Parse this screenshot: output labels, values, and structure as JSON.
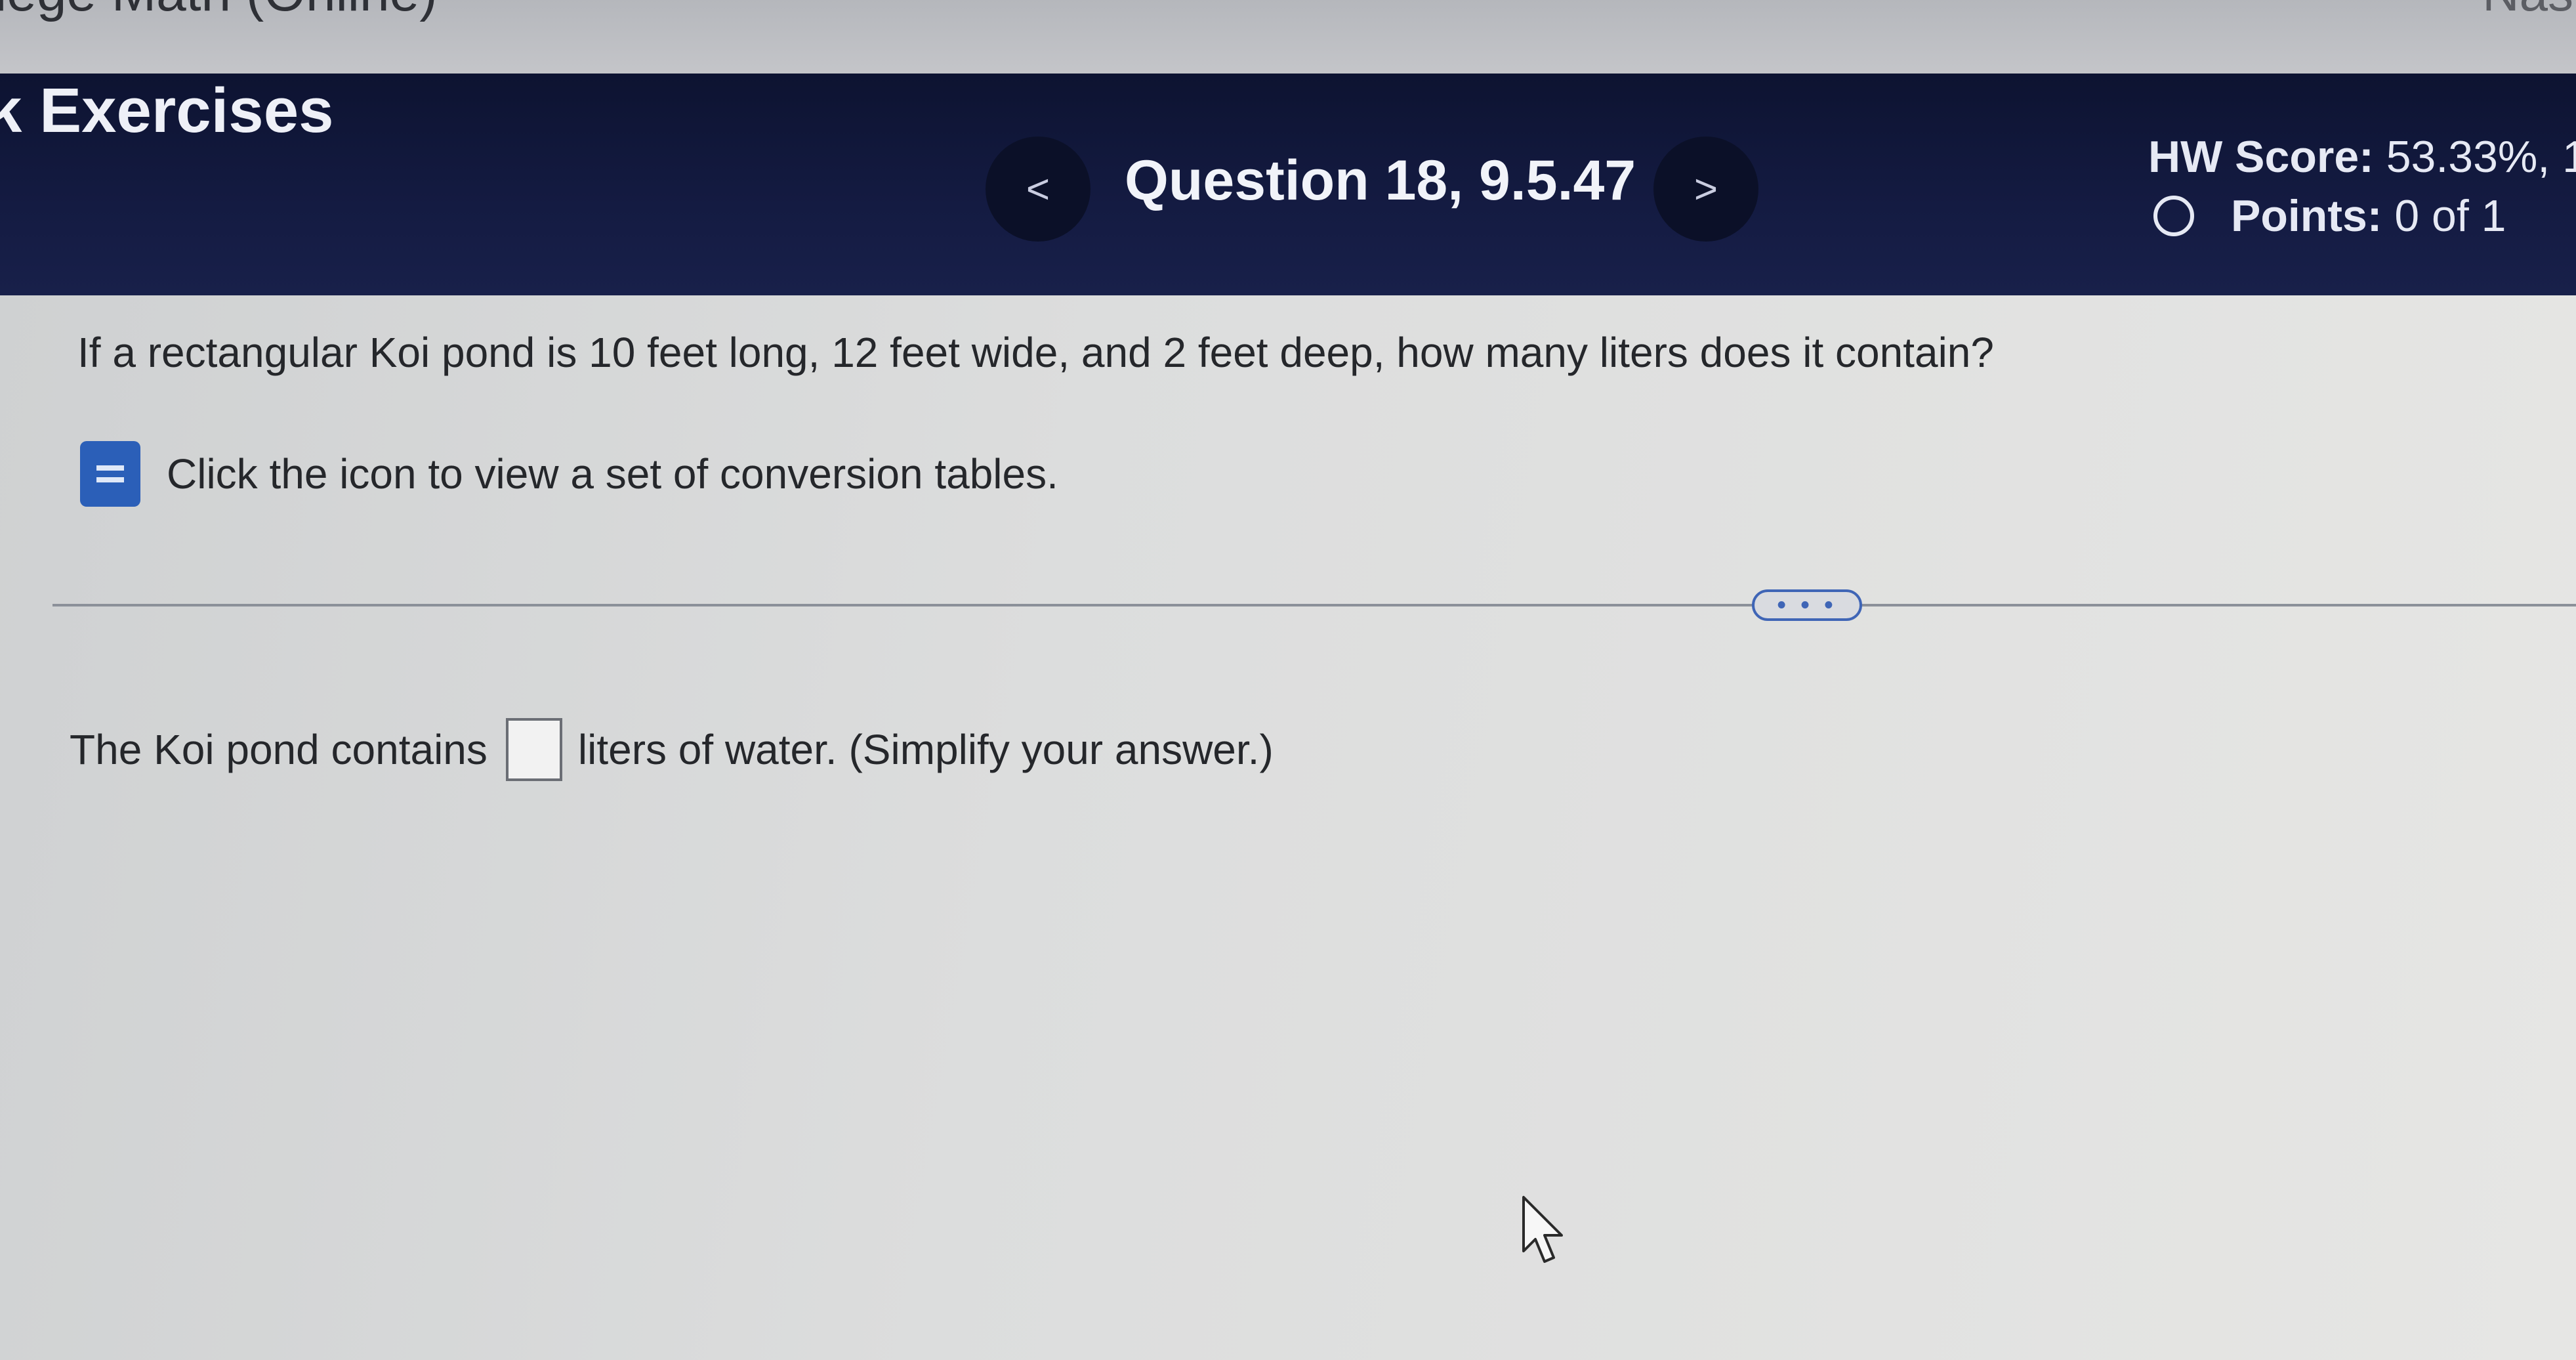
{
  "top_bar": {
    "course_title": "lege Math (Online)",
    "user_name": "Nas"
  },
  "header": {
    "section_title": "k Exercises",
    "prev_label": "<",
    "question_title": "Question 18, 9.5.47",
    "next_label": ">",
    "hw_score_label": "HW Score:",
    "hw_score_value": "53.33%, 1",
    "points_label": "Points:",
    "points_value": "0 of 1"
  },
  "question": {
    "text": "If a rectangular Koi pond is 10 feet long, 12 feet wide, and 2 feet deep, how many liters does it contain?",
    "conversion_link_text": "Click the icon to view a set of conversion tables.",
    "more_button_label": "• • •"
  },
  "answer": {
    "prefix": "The Koi pond contains",
    "input_value": "",
    "suffix": "liters of water. (Simplify your answer.)"
  },
  "icons": {
    "conversion_table": "table-icon",
    "points_status": "circle-icon",
    "cursor": "mouse-pointer-icon"
  },
  "colors": {
    "header_bg": "#141b42",
    "accent": "#2b5fb8"
  }
}
